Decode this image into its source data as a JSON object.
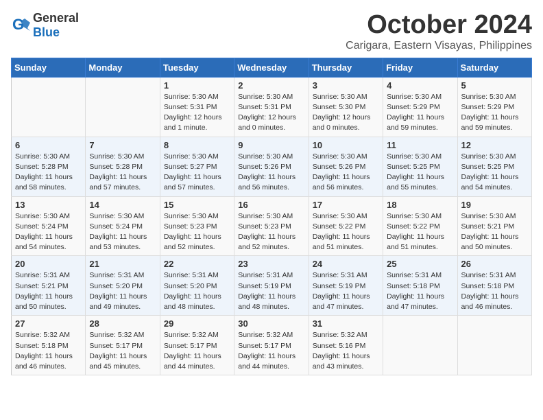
{
  "logo": {
    "text_general": "General",
    "text_blue": "Blue"
  },
  "header": {
    "month": "October 2024",
    "location": "Carigara, Eastern Visayas, Philippines"
  },
  "weekdays": [
    "Sunday",
    "Monday",
    "Tuesday",
    "Wednesday",
    "Thursday",
    "Friday",
    "Saturday"
  ],
  "weeks": [
    [
      {
        "day": "",
        "info": ""
      },
      {
        "day": "",
        "info": ""
      },
      {
        "day": "1",
        "info": "Sunrise: 5:30 AM\nSunset: 5:31 PM\nDaylight: 12 hours and 1 minute."
      },
      {
        "day": "2",
        "info": "Sunrise: 5:30 AM\nSunset: 5:31 PM\nDaylight: 12 hours and 0 minutes."
      },
      {
        "day": "3",
        "info": "Sunrise: 5:30 AM\nSunset: 5:30 PM\nDaylight: 12 hours and 0 minutes."
      },
      {
        "day": "4",
        "info": "Sunrise: 5:30 AM\nSunset: 5:29 PM\nDaylight: 11 hours and 59 minutes."
      },
      {
        "day": "5",
        "info": "Sunrise: 5:30 AM\nSunset: 5:29 PM\nDaylight: 11 hours and 59 minutes."
      }
    ],
    [
      {
        "day": "6",
        "info": "Sunrise: 5:30 AM\nSunset: 5:28 PM\nDaylight: 11 hours and 58 minutes."
      },
      {
        "day": "7",
        "info": "Sunrise: 5:30 AM\nSunset: 5:28 PM\nDaylight: 11 hours and 57 minutes."
      },
      {
        "day": "8",
        "info": "Sunrise: 5:30 AM\nSunset: 5:27 PM\nDaylight: 11 hours and 57 minutes."
      },
      {
        "day": "9",
        "info": "Sunrise: 5:30 AM\nSunset: 5:26 PM\nDaylight: 11 hours and 56 minutes."
      },
      {
        "day": "10",
        "info": "Sunrise: 5:30 AM\nSunset: 5:26 PM\nDaylight: 11 hours and 56 minutes."
      },
      {
        "day": "11",
        "info": "Sunrise: 5:30 AM\nSunset: 5:25 PM\nDaylight: 11 hours and 55 minutes."
      },
      {
        "day": "12",
        "info": "Sunrise: 5:30 AM\nSunset: 5:25 PM\nDaylight: 11 hours and 54 minutes."
      }
    ],
    [
      {
        "day": "13",
        "info": "Sunrise: 5:30 AM\nSunset: 5:24 PM\nDaylight: 11 hours and 54 minutes."
      },
      {
        "day": "14",
        "info": "Sunrise: 5:30 AM\nSunset: 5:24 PM\nDaylight: 11 hours and 53 minutes."
      },
      {
        "day": "15",
        "info": "Sunrise: 5:30 AM\nSunset: 5:23 PM\nDaylight: 11 hours and 52 minutes."
      },
      {
        "day": "16",
        "info": "Sunrise: 5:30 AM\nSunset: 5:23 PM\nDaylight: 11 hours and 52 minutes."
      },
      {
        "day": "17",
        "info": "Sunrise: 5:30 AM\nSunset: 5:22 PM\nDaylight: 11 hours and 51 minutes."
      },
      {
        "day": "18",
        "info": "Sunrise: 5:30 AM\nSunset: 5:22 PM\nDaylight: 11 hours and 51 minutes."
      },
      {
        "day": "19",
        "info": "Sunrise: 5:30 AM\nSunset: 5:21 PM\nDaylight: 11 hours and 50 minutes."
      }
    ],
    [
      {
        "day": "20",
        "info": "Sunrise: 5:31 AM\nSunset: 5:21 PM\nDaylight: 11 hours and 50 minutes."
      },
      {
        "day": "21",
        "info": "Sunrise: 5:31 AM\nSunset: 5:20 PM\nDaylight: 11 hours and 49 minutes."
      },
      {
        "day": "22",
        "info": "Sunrise: 5:31 AM\nSunset: 5:20 PM\nDaylight: 11 hours and 48 minutes."
      },
      {
        "day": "23",
        "info": "Sunrise: 5:31 AM\nSunset: 5:19 PM\nDaylight: 11 hours and 48 minutes."
      },
      {
        "day": "24",
        "info": "Sunrise: 5:31 AM\nSunset: 5:19 PM\nDaylight: 11 hours and 47 minutes."
      },
      {
        "day": "25",
        "info": "Sunrise: 5:31 AM\nSunset: 5:18 PM\nDaylight: 11 hours and 47 minutes."
      },
      {
        "day": "26",
        "info": "Sunrise: 5:31 AM\nSunset: 5:18 PM\nDaylight: 11 hours and 46 minutes."
      }
    ],
    [
      {
        "day": "27",
        "info": "Sunrise: 5:32 AM\nSunset: 5:18 PM\nDaylight: 11 hours and 46 minutes."
      },
      {
        "day": "28",
        "info": "Sunrise: 5:32 AM\nSunset: 5:17 PM\nDaylight: 11 hours and 45 minutes."
      },
      {
        "day": "29",
        "info": "Sunrise: 5:32 AM\nSunset: 5:17 PM\nDaylight: 11 hours and 44 minutes."
      },
      {
        "day": "30",
        "info": "Sunrise: 5:32 AM\nSunset: 5:17 PM\nDaylight: 11 hours and 44 minutes."
      },
      {
        "day": "31",
        "info": "Sunrise: 5:32 AM\nSunset: 5:16 PM\nDaylight: 11 hours and 43 minutes."
      },
      {
        "day": "",
        "info": ""
      },
      {
        "day": "",
        "info": ""
      }
    ]
  ]
}
